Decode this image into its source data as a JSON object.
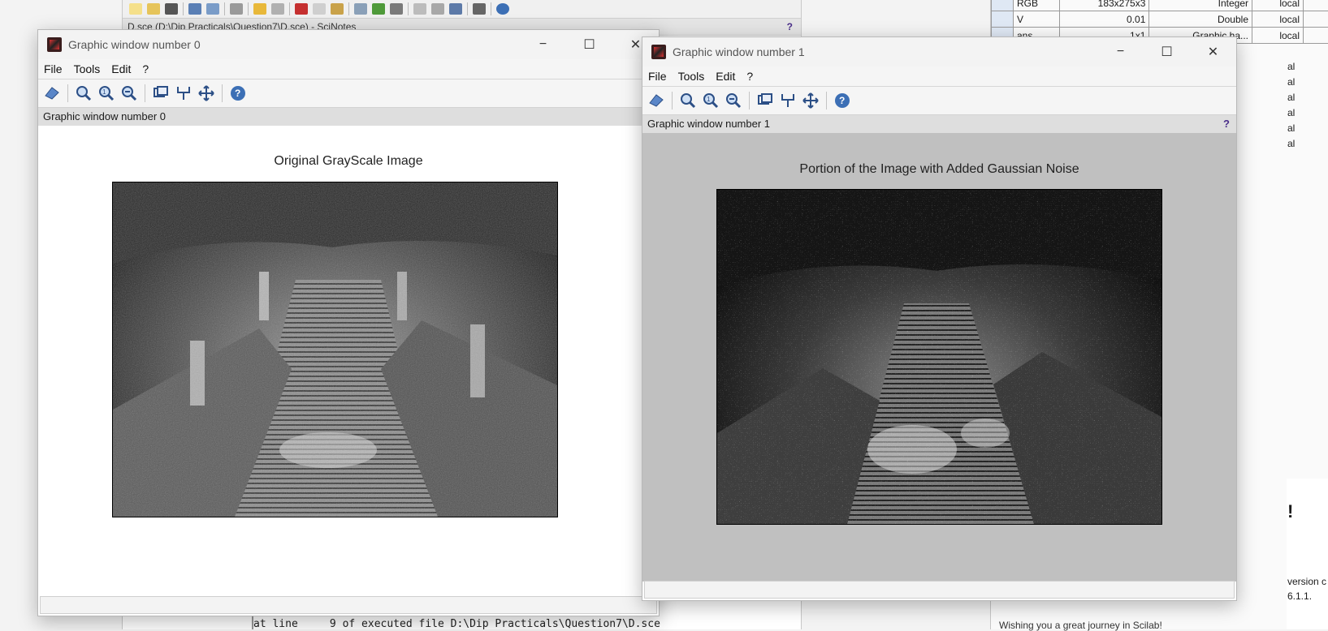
{
  "background": {
    "editor_title": "D.sce (D:\\Dip Practicals\\Question7\\D.sce) - SciNotes",
    "editor_help": "?",
    "console_line": "at line     9 of executed file D:\\Dip Practicals\\Question7\\D.sce",
    "variables": [
      {
        "name": "RGB",
        "size": "183x275x3",
        "type": "Integer",
        "scope": "local"
      },
      {
        "name": "V",
        "size": "0.01",
        "type": "Double",
        "scope": "local"
      },
      {
        "name": "ans",
        "size": "1x1",
        "type": "Graphic ha...",
        "scope": "local"
      }
    ],
    "var_scope_stub": "al",
    "news_excl": "!",
    "news_version": "version c",
    "news_number": "6.1.1.",
    "news_welcome": "Wishing you a great journey in Scilab!"
  },
  "windows": [
    {
      "title": "Graphic window number 0",
      "menu": [
        "File",
        "Tools",
        "Edit",
        "?"
      ],
      "info": "Graphic window number 0",
      "plot_title": "Original GrayScale Image",
      "bg": "#ffffff"
    },
    {
      "title": "Graphic window number 1",
      "menu": [
        "File",
        "Tools",
        "Edit",
        "?"
      ],
      "info": "Graphic window number 1",
      "info_help": "?",
      "plot_title": "Portion of the Image with Added Gaussian Noise",
      "bg": "#c0c0c0"
    }
  ],
  "icons": {
    "minimize": "−",
    "maximize": "☐",
    "close": "✕"
  }
}
